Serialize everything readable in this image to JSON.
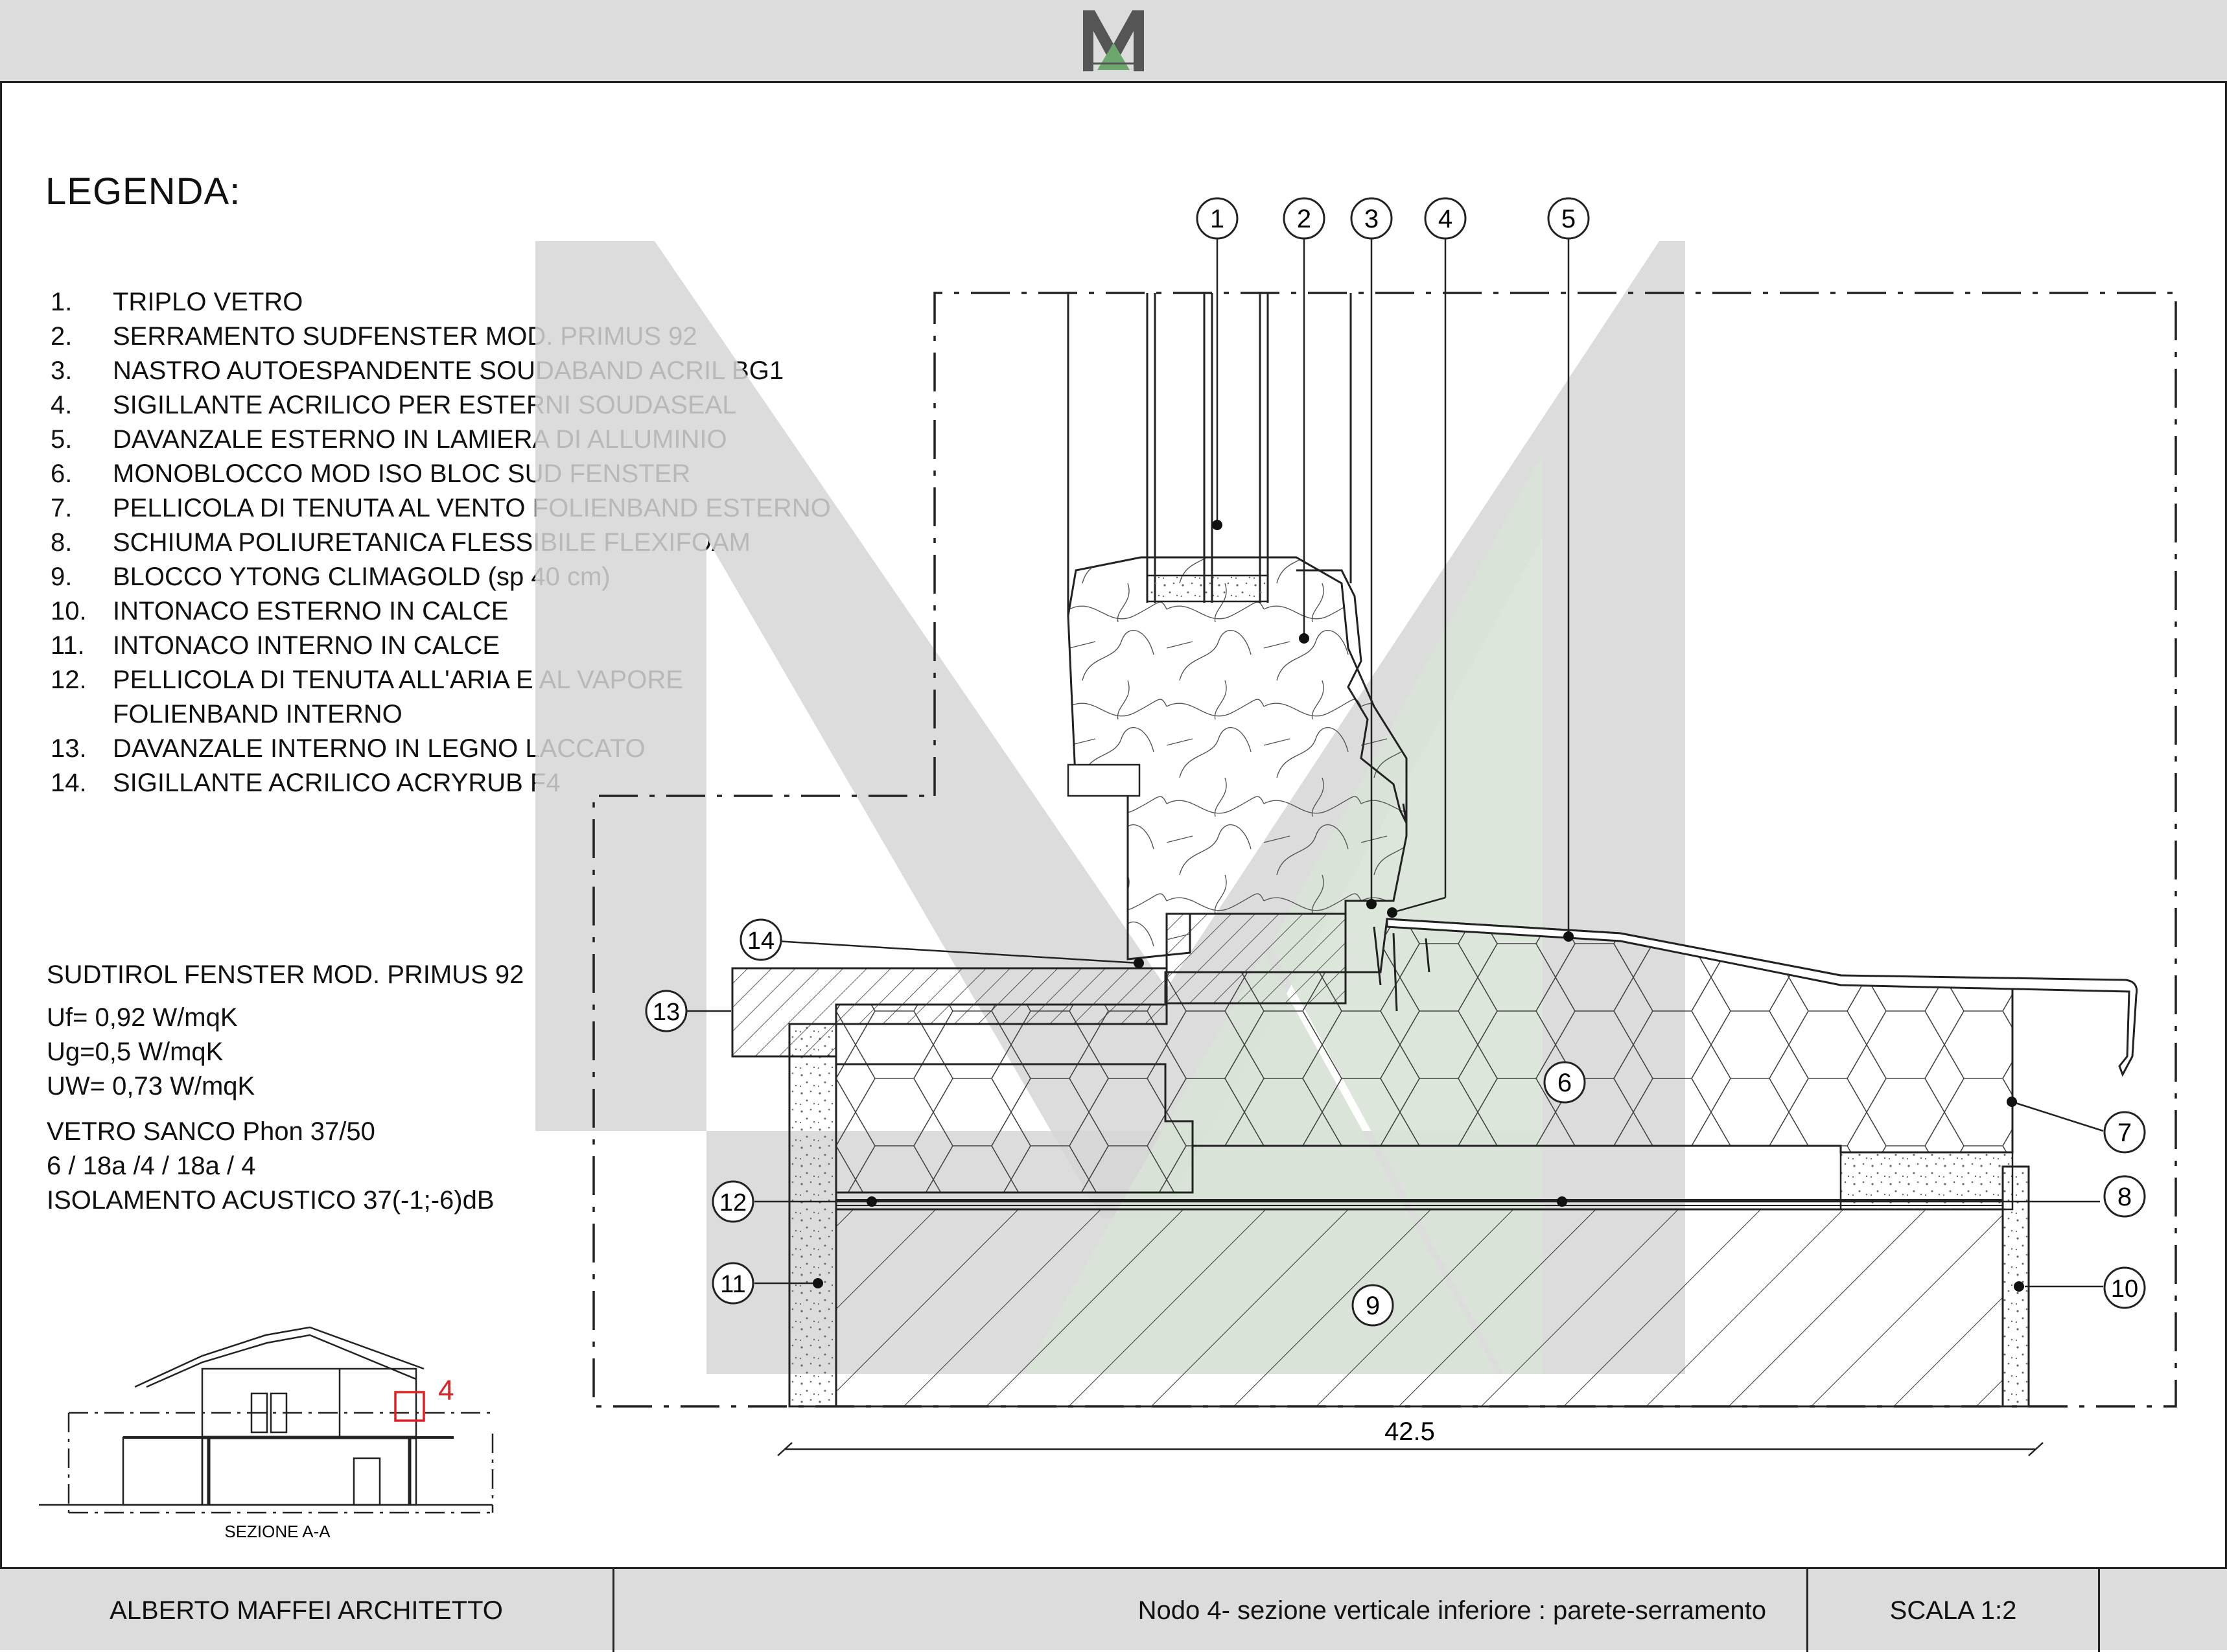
{
  "header": {
    "logo_letter": "M"
  },
  "legend": {
    "title": "LEGENDA:",
    "items": [
      {
        "num": "1.",
        "label": "TRIPLO VETRO"
      },
      {
        "num": "2.",
        "label": "SERRAMENTO SUDFENSTER MOD. PRIMUS 92"
      },
      {
        "num": "3.",
        "label": "NASTRO AUTOESPANDENTE  SOUDABAND ACRIL BG1"
      },
      {
        "num": "4.",
        "label": "SIGILLANTE ACRILICO PER ESTERNI SOUDASEAL"
      },
      {
        "num": "5.",
        "label": "DAVANZALE ESTERNO IN LAMIERA DI ALLUMINIO"
      },
      {
        "num": "6.",
        "label": "MONOBLOCCO MOD ISO BLOC SUD FENSTER"
      },
      {
        "num": "7.",
        "label": "PELLICOLA DI TENUTA AL VENTO FOLIENBAND ESTERNO"
      },
      {
        "num": "8.",
        "label": "SCHIUMA POLIURETANICA FLESSIBILE FLEXIFOAM"
      },
      {
        "num": "9.",
        "label": "BLOCCO YTONG CLIMAGOLD (sp 40 cm)"
      },
      {
        "num": "10.",
        "label": "INTONACO ESTERNO IN CALCE"
      },
      {
        "num": "11.",
        "label": "INTONACO INTERNO IN CALCE"
      },
      {
        "num": "12.",
        "label": "PELLICOLA DI TENUTA ALL'ARIA E AL VAPORE"
      },
      {
        "num": "",
        "label": "FOLIENBAND INTERNO"
      },
      {
        "num": "13.",
        "label": "DAVANZALE INTERNO IN LEGNO LACCATO"
      },
      {
        "num": "14.",
        "label": "SIGILLANTE ACRILICO ACRYRUB F4"
      }
    ]
  },
  "specs": {
    "window_model": "SUDTIROL FENSTER MOD. PRIMUS 92",
    "uf": "Uf= 0,92 W/mqK",
    "ug": "Ug=0,5  W/mqK",
    "uw": "UW= 0,73 W/mqK",
    "glass": "VETRO SANCO Phon 37/50",
    "glass_layers": "6 / 18a /4 / 18a / 4",
    "acoustic": "ISOLAMENTO ACUSTICO 37(-1;-6)dB"
  },
  "detail": {
    "callouts": [
      "1",
      "2",
      "3",
      "4",
      "5",
      "6",
      "7",
      "8",
      "9",
      "10",
      "11",
      "12",
      "13",
      "14"
    ],
    "dimension": "42.5"
  },
  "keyplan": {
    "node_marker": "4",
    "section_label": "SEZIONE A-A"
  },
  "title_block": {
    "author": "ALBERTO MAFFEI ARCHITETTO",
    "title": "Nodo 4- sezione verticale inferiore : parete-serramento",
    "scale": "SCALA 1:2"
  },
  "colors": {
    "band": "#dcdcdc",
    "watermark_gray": "#d6d6d6",
    "watermark_green": "#d8e3d6",
    "logo_green": "#6ca86c",
    "marker_red": "#e02020",
    "line": "#222222"
  }
}
